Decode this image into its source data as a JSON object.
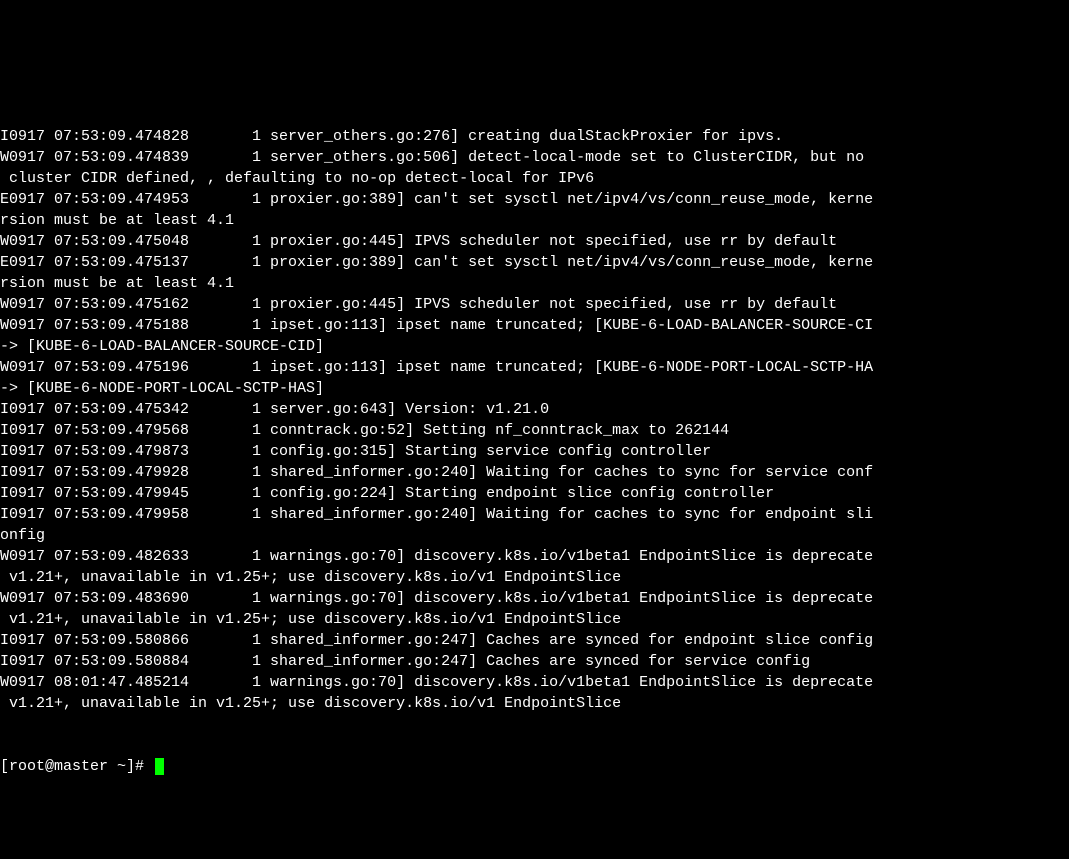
{
  "lines": [
    "I0917 07:53:09.474828       1 server_others.go:276] creating dualStackProxier for ipvs.",
    "W0917 07:53:09.474839       1 server_others.go:506] detect-local-mode set to ClusterCIDR, but no ",
    " cluster CIDR defined, , defaulting to no-op detect-local for IPv6",
    "E0917 07:53:09.474953       1 proxier.go:389] can't set sysctl net/ipv4/vs/conn_reuse_mode, kerne",
    "rsion must be at least 4.1",
    "W0917 07:53:09.475048       1 proxier.go:445] IPVS scheduler not specified, use rr by default",
    "E0917 07:53:09.475137       1 proxier.go:389] can't set sysctl net/ipv4/vs/conn_reuse_mode, kerne",
    "rsion must be at least 4.1",
    "W0917 07:53:09.475162       1 proxier.go:445] IPVS scheduler not specified, use rr by default",
    "W0917 07:53:09.475188       1 ipset.go:113] ipset name truncated; [KUBE-6-LOAD-BALANCER-SOURCE-CI",
    "-> [KUBE-6-LOAD-BALANCER-SOURCE-CID]",
    "W0917 07:53:09.475196       1 ipset.go:113] ipset name truncated; [KUBE-6-NODE-PORT-LOCAL-SCTP-HA",
    "-> [KUBE-6-NODE-PORT-LOCAL-SCTP-HAS]",
    "I0917 07:53:09.475342       1 server.go:643] Version: v1.21.0",
    "I0917 07:53:09.479568       1 conntrack.go:52] Setting nf_conntrack_max to 262144",
    "I0917 07:53:09.479873       1 config.go:315] Starting service config controller",
    "I0917 07:53:09.479928       1 shared_informer.go:240] Waiting for caches to sync for service conf",
    "I0917 07:53:09.479945       1 config.go:224] Starting endpoint slice config controller",
    "I0917 07:53:09.479958       1 shared_informer.go:240] Waiting for caches to sync for endpoint sli",
    "onfig",
    "W0917 07:53:09.482633       1 warnings.go:70] discovery.k8s.io/v1beta1 EndpointSlice is deprecate",
    " v1.21+, unavailable in v1.25+; use discovery.k8s.io/v1 EndpointSlice",
    "W0917 07:53:09.483690       1 warnings.go:70] discovery.k8s.io/v1beta1 EndpointSlice is deprecate",
    " v1.21+, unavailable in v1.25+; use discovery.k8s.io/v1 EndpointSlice",
    "I0917 07:53:09.580866       1 shared_informer.go:247] Caches are synced for endpoint slice config",
    "I0917 07:53:09.580884       1 shared_informer.go:247] Caches are synced for service config",
    "W0917 08:01:47.485214       1 warnings.go:70] discovery.k8s.io/v1beta1 EndpointSlice is deprecate",
    " v1.21+, unavailable in v1.25+; use discovery.k8s.io/v1 EndpointSlice"
  ],
  "prompt": "[root@master ~]# "
}
